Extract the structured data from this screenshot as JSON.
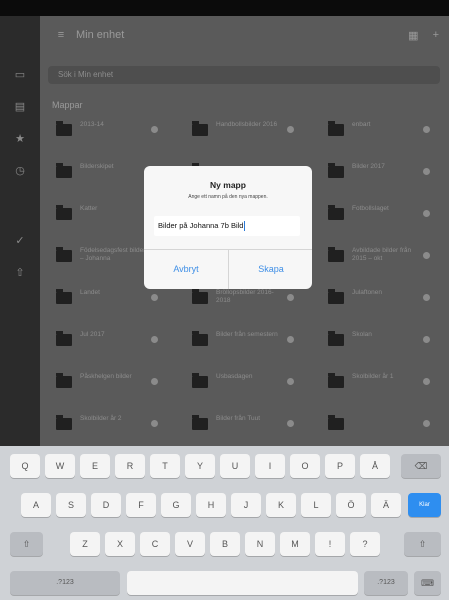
{
  "app": {
    "title": "Min enhet",
    "search_placeholder": "Sök i Min enhet",
    "section": "Mappar",
    "folders": [
      [
        "2013-14",
        "Handbollsbilder 2016",
        "enbart"
      ],
      [
        "Bilderskipet",
        "",
        "Bilder 2017"
      ],
      [
        "Katter",
        "",
        "Fotbollslaget"
      ],
      [
        "Födelsedagsfest bilder – Johanna",
        "",
        "Avbildade bilder från 2015 – okt"
      ],
      [
        "Landet",
        "Bröllopsbilder 2016-2018",
        "Julaftonen"
      ],
      [
        "Jul 2017",
        "Bilder från semestern",
        "Skolan"
      ],
      [
        "Påskhelgen bilder",
        "Usbasdagen",
        "Skolbilder år 1"
      ],
      [
        "Skolbilder år 2",
        "Bilder från Tuut",
        ""
      ]
    ]
  },
  "dialog": {
    "title": "Ny mapp",
    "message": "Ange ett namn på den nya mappen.",
    "input_value": "Bilder på Johanna 7b Bild",
    "cancel_label": "Avbryt",
    "create_label": "Skapa"
  },
  "keyboard": {
    "row1": [
      "Q",
      "W",
      "E",
      "R",
      "T",
      "Y",
      "U",
      "I",
      "O",
      "P",
      "Å"
    ],
    "row2": [
      "A",
      "S",
      "D",
      "F",
      "G",
      "H",
      "J",
      "K",
      "L",
      "Ö",
      "Ä"
    ],
    "row3": [
      "Z",
      "X",
      "C",
      "V",
      "B",
      "N",
      "M",
      "!",
      "?"
    ],
    "return_label": "Klar",
    "numbers_label": ".?123",
    "numbers_label_right": ".?123"
  },
  "colors": {
    "accent": "#3f8fe6",
    "return_key": "#2e8ef0"
  }
}
